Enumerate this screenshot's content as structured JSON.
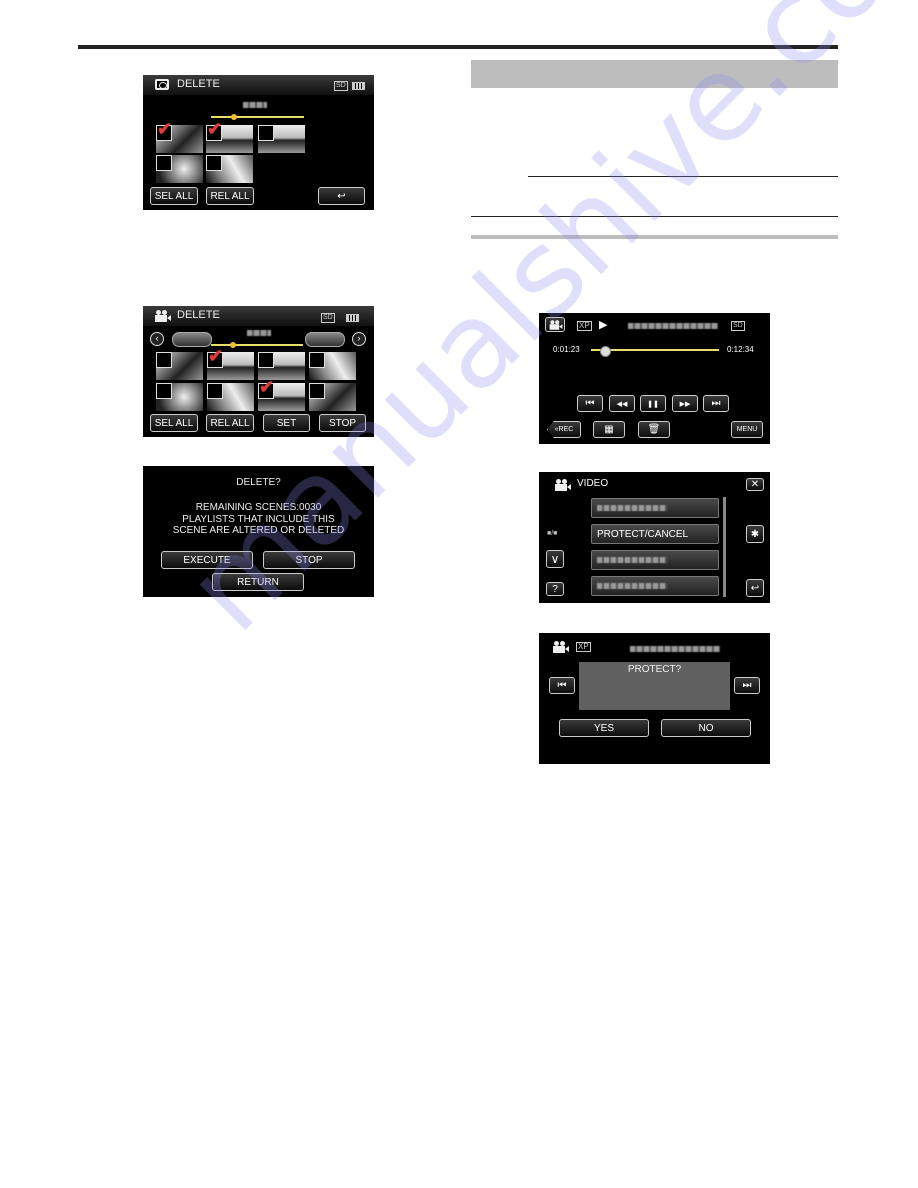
{
  "watermark": "manualshive.com",
  "screens": {
    "delete_stills": {
      "title": "DELETE",
      "storage_badge": "SD",
      "buttons": {
        "select_all": "SEL ALL",
        "release_all": "REL ALL",
        "back": "↩"
      },
      "thumbnails": [
        {
          "checked": true
        },
        {
          "checked": true
        },
        {
          "checked": false
        },
        {
          "checked": false
        },
        {
          "checked": false
        }
      ]
    },
    "delete_videos": {
      "title": "DELETE",
      "storage_badge": "SD",
      "nav": {
        "prev": "‹",
        "next": "›"
      },
      "buttons": {
        "select_all": "SEL ALL",
        "release_all": "REL ALL",
        "set": "SET",
        "stop": "STOP"
      },
      "thumbnails": [
        {
          "checked": false
        },
        {
          "checked": true
        },
        {
          "checked": false
        },
        {
          "checked": false
        },
        {
          "checked": false
        },
        {
          "checked": false
        },
        {
          "checked": true
        },
        {
          "checked": false
        }
      ]
    },
    "delete_confirm": {
      "title": "DELETE?",
      "line1": "REMAINING SCENES:0030",
      "line2": "PLAYLISTS THAT INCLUDE THIS",
      "line3": "SCENE ARE ALTERED OR DELETED",
      "buttons": {
        "execute": "EXECUTE",
        "stop": "STOP",
        "return": "RETURN"
      }
    },
    "playback": {
      "quality": "XP",
      "play_state": "▶",
      "storage_badge": "SD",
      "elapsed": "0:01:23",
      "total": "0:12:34",
      "progress": 0.11,
      "controls": {
        "skip_back": "⏮",
        "rewind": "◀◀",
        "pause": "❚❚",
        "fast_forward": "▶▶",
        "skip_forward": "⏭"
      },
      "buttons": {
        "rec": "«REC",
        "index": "▦",
        "trash": "🗑",
        "menu": "MENU"
      }
    },
    "video_menu": {
      "title": "VIDEO",
      "page_indicator": "■/■",
      "items": [
        "",
        "PROTECT/CANCEL",
        "",
        ""
      ],
      "buttons": {
        "close": "✕",
        "settings": "✱",
        "down": "∨",
        "help": "?",
        "back": "↩"
      }
    },
    "protect_confirm": {
      "quality": "XP",
      "message": "PROTECT?",
      "buttons": {
        "yes": "YES",
        "no": "NO",
        "prev": "⏮",
        "next": "⏭"
      }
    }
  }
}
